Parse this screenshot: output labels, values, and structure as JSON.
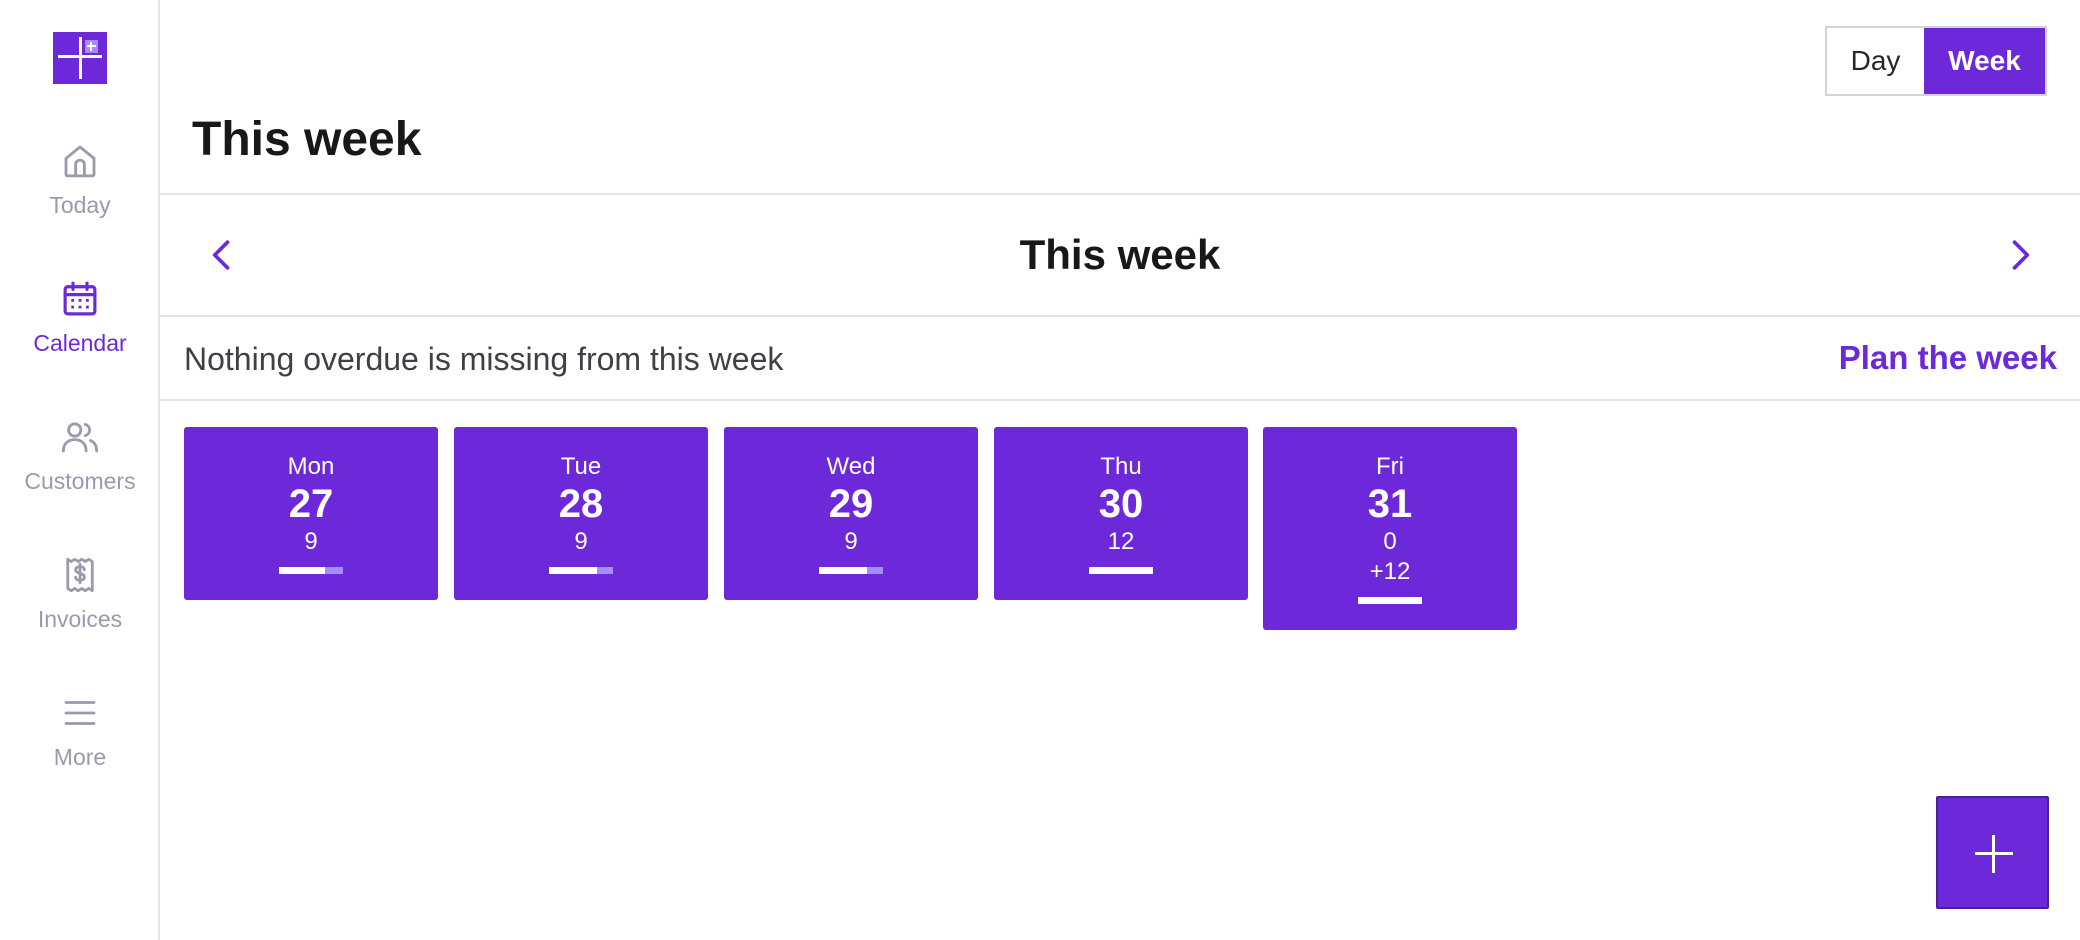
{
  "sidebar": {
    "items": [
      {
        "label": "Today",
        "icon": "home-icon",
        "active": false
      },
      {
        "label": "Calendar",
        "icon": "calendar-icon",
        "active": true
      },
      {
        "label": "Customers",
        "icon": "users-icon",
        "active": false
      },
      {
        "label": "Invoices",
        "icon": "receipt-dollar-icon",
        "active": false
      },
      {
        "label": "More",
        "icon": "menu-icon",
        "active": false
      }
    ]
  },
  "view_toggle": {
    "day_label": "Day",
    "week_label": "Week",
    "selected": "Week"
  },
  "page_title": "This week",
  "week_nav": {
    "title": "This week"
  },
  "info": {
    "text": "Nothing overdue is missing from this week",
    "action_label": "Plan the week"
  },
  "days": [
    {
      "name": "Mon",
      "date": "27",
      "count": "9",
      "extra": "",
      "progress": 0.72
    },
    {
      "name": "Tue",
      "date": "28",
      "count": "9",
      "extra": "",
      "progress": 0.75
    },
    {
      "name": "Wed",
      "date": "29",
      "count": "9",
      "extra": "",
      "progress": 0.75
    },
    {
      "name": "Thu",
      "date": "30",
      "count": "12",
      "extra": "",
      "progress": 1.0
    },
    {
      "name": "Fri",
      "date": "31",
      "count": "0",
      "extra": "+12",
      "progress": 1.0
    }
  ],
  "colors": {
    "accent": "#6d28d9",
    "accent_light": "#a78bfa",
    "muted": "#9a9aaf",
    "divider": "#e4e4e7"
  },
  "fab": {
    "icon": "plus-icon"
  }
}
